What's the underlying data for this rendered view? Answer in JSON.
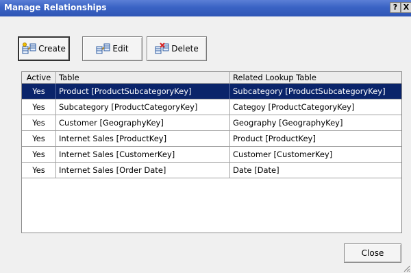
{
  "window": {
    "title": "Manage Relationships",
    "help_label": "?",
    "close_label": "X"
  },
  "toolbar": {
    "create_label": "Create",
    "edit_label": "Edit",
    "delete_label": "Delete"
  },
  "grid": {
    "columns": [
      "Active",
      "Table",
      "Related Lookup Table"
    ],
    "rows": [
      {
        "active": "Yes",
        "table": "Product [ProductSubcategoryKey]",
        "related": "Subcategory [ProductSubcategoryKey]",
        "selected": true
      },
      {
        "active": "Yes",
        "table": "Subcategory [ProductCategoryKey]",
        "related": "Categoy [ProductCategoryKey]"
      },
      {
        "active": "Yes",
        "table": "Customer [GeographyKey]",
        "related": "Geography [GeographyKey]"
      },
      {
        "active": "Yes",
        "table": "Internet Sales [ProductKey]",
        "related": "Product [ProductKey]"
      },
      {
        "active": "Yes",
        "table": "Internet Sales [CustomerKey]",
        "related": "Customer [CustomerKey]"
      },
      {
        "active": "Yes",
        "table": "Internet Sales [Order Date]",
        "related": "Date [Date]"
      }
    ]
  },
  "footer": {
    "close_label": "Close"
  },
  "colors": {
    "titlebar": "#3a63c4",
    "selection": "#0a246a"
  },
  "icons": [
    "create-relationship-icon",
    "edit-relationship-icon",
    "delete-relationship-icon",
    "resize-grip-icon"
  ]
}
